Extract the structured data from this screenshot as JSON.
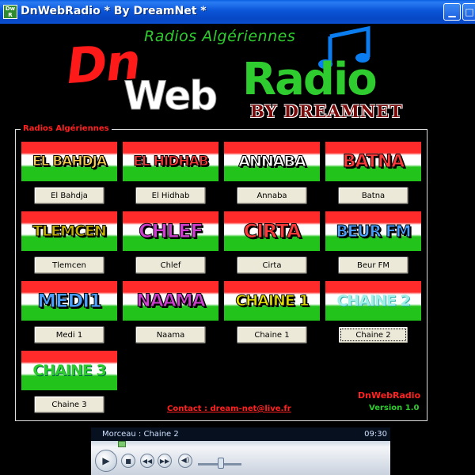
{
  "window": {
    "title": "DnWebRadio * By DreamNet *",
    "icon_text_top": "Dw",
    "icon_text_bottom": "R",
    "controls": [
      "minimize",
      "maximize"
    ]
  },
  "logo": {
    "subtitle": "Radios Algériennes",
    "dn": "Dn",
    "web": "Web",
    "radio": "Radio",
    "by": "BY DREAMNET",
    "icon": "music-note-icon"
  },
  "group": {
    "title": "Radios Algériennes"
  },
  "stations": [
    {
      "banner": "EL BAHDJA",
      "label": "El Bahdja",
      "color": "#ffd24d"
    },
    {
      "banner": "EL HIDHAB",
      "label": "El Hidhab",
      "color": "#ff3a3a"
    },
    {
      "banner": "ANNABA",
      "label": "Annaba",
      "color": "#ffffff"
    },
    {
      "banner": "BATNA",
      "label": "Batna",
      "color": "#ff3a3a"
    },
    {
      "banner": "TLEMCEN",
      "label": "Tlemcen",
      "color": "#c8b400"
    },
    {
      "banner": "CHLEF",
      "label": "Chlef",
      "color": "#d040d0"
    },
    {
      "banner": "CIRTA",
      "label": "Cirta",
      "color": "#ff3a3a"
    },
    {
      "banner": "BEUR FM",
      "label": "Beur FM",
      "color": "#4aa0ff"
    },
    {
      "banner": "MEDI1",
      "label": "Medi 1",
      "color": "#4aa0ff"
    },
    {
      "banner": "NAAMA",
      "label": "Naama",
      "color": "#d040d0"
    },
    {
      "banner": "CHAINE 1",
      "label": "Chaine 1",
      "color": "#e8e000"
    },
    {
      "banner": "CHAINE 2",
      "label": "Chaine 2",
      "color": "#a0f0e8"
    },
    {
      "banner": "CHAINE 3",
      "label": "Chaine 3",
      "color": "#2ecc2e"
    }
  ],
  "selected_station": "Chaine 2",
  "footer": {
    "app_name": "DnWebRadio",
    "version": "Version 1.0",
    "contact": "Contact : dream-net@live.fr"
  },
  "player": {
    "now_playing": "Morceau : Chaine 2",
    "time": "09:30",
    "buttons": [
      "play-icon",
      "stop-icon",
      "previous-icon",
      "next-icon",
      "volume-icon"
    ]
  }
}
